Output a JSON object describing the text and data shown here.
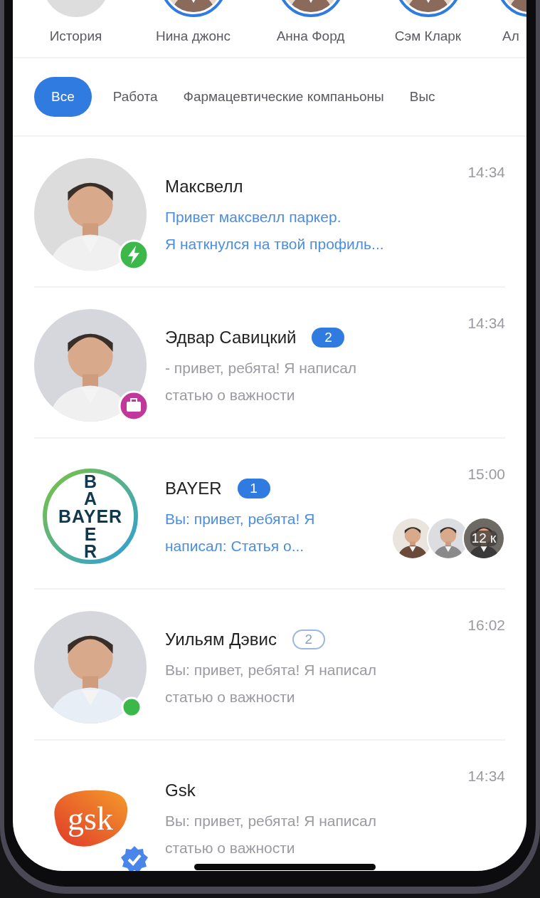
{
  "stories": [
    {
      "name": "История",
      "ring": false
    },
    {
      "name": "Нина джонс",
      "ring": true
    },
    {
      "name": "Анна Форд",
      "ring": true
    },
    {
      "name": "Сэм Кларк",
      "ring": true
    },
    {
      "name": "Ал",
      "ring": true
    }
  ],
  "filters": [
    {
      "label": "Все",
      "selected": true
    },
    {
      "label": "Работа",
      "selected": false
    },
    {
      "label": "Фармацевтические компаньоны",
      "selected": false
    },
    {
      "label": "Выс",
      "selected": false
    }
  ],
  "chats": [
    {
      "name": "Максвелл",
      "status": {
        "kind": "lightning"
      },
      "time": "14:34",
      "preview": "Привет максвелл паркер.\nЯ наткнулся на твой профиль...",
      "highlight": true
    },
    {
      "name": "Эдвар Савицкий",
      "status": {
        "kind": "briefcase"
      },
      "badge": {
        "text": "2",
        "kind": "filled"
      },
      "time": "14:34",
      "preview": "- привет, ребята! Я написал\nстатью о важности",
      "highlight": false
    },
    {
      "name": "BAYER",
      "avatar": {
        "kind": "cross",
        "top": "BA",
        "text": "BAYER",
        "bottom": "ER"
      },
      "badge": {
        "text": "1",
        "kind": "filled"
      },
      "time": "15:00",
      "preview": "Вы: привет, ребята! Я\nнаписал: Статья о...",
      "highlight": true,
      "members_count": "12 к"
    },
    {
      "name": "Уильям Дэвис",
      "status": {
        "kind": "online"
      },
      "badge": {
        "text": "2",
        "kind": "outline"
      },
      "time": "16:02",
      "preview": "Вы: привет, ребята! Я написал\nстатью о важности",
      "highlight": false
    },
    {
      "name": "Gsk",
      "avatar": {
        "kind": "blob",
        "text": "gsk"
      },
      "status": {
        "kind": "verified"
      },
      "time": "14:34",
      "preview": "Вы: привет, ребята! Я написал\nстатью о важности",
      "highlight": false
    }
  ]
}
